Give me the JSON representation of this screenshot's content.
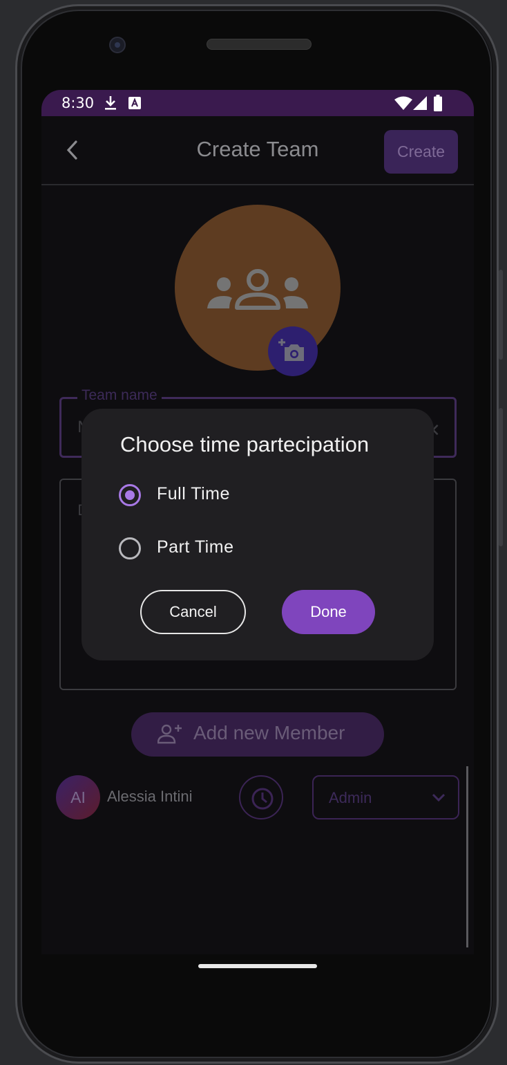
{
  "status_bar": {
    "time": "8:30",
    "icons": [
      "download-icon",
      "keyboard-a-icon",
      "wifi-icon",
      "signal-icon",
      "battery-icon"
    ]
  },
  "app_bar": {
    "title": "Create Team",
    "create_label": "Create"
  },
  "form": {
    "team_name_label": "Team name",
    "team_name_value": "N",
    "description_label": "D"
  },
  "members": {
    "add_button_label": "Add new Member",
    "list": [
      {
        "initials": "AI",
        "name": "Alessia Intini",
        "role": "Admin"
      }
    ]
  },
  "dialog": {
    "title": "Choose time partecipation",
    "options": [
      {
        "label": "Full Time",
        "selected": true
      },
      {
        "label": "Part Time",
        "selected": false
      }
    ],
    "cancel_label": "Cancel",
    "done_label": "Done"
  },
  "colors": {
    "status_bar": "#3a1a4e",
    "accent": "#7f45bd",
    "radio_accent": "#a879e6",
    "dialog_bg": "#201f22",
    "avatar_bg": "#5e3c21"
  }
}
